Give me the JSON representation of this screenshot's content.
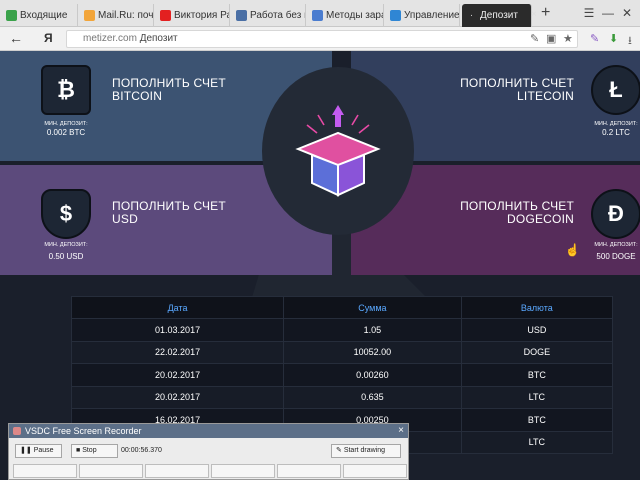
{
  "browser": {
    "tabs": [
      {
        "label": "Входящие",
        "color": "#3aa24a"
      },
      {
        "label": "Mail.Ru: почта",
        "color": "#f2a53a"
      },
      {
        "label": "Виктория Раб",
        "color": "#e32020"
      },
      {
        "label": "Работа без вл",
        "color": "#4a6fa5"
      },
      {
        "label": "Методы зараб",
        "color": "#4a7ccf"
      },
      {
        "label": "Управление н",
        "color": "#2f86d4"
      },
      {
        "label": "Депозит",
        "color": "#2b2b2b"
      }
    ],
    "active_tab": 6,
    "tab_close": "×",
    "new_tab": "+",
    "back": "←",
    "logo": "Я",
    "url_host": "metizer.com",
    "url_title": "Депозит"
  },
  "cards": [
    {
      "title_line1": "ПОПОЛНИТЬ СЧЕТ",
      "title_line2": "BITCOIN",
      "min_label": "МИН. ДЕПОЗИТ:",
      "min_value": "0.002 BTC",
      "icon": "bitcoin-icon",
      "glyph": "₿",
      "color": "#3c5372"
    },
    {
      "title_line1": "ПОПОЛНИТЬ СЧЕТ",
      "title_line2": "LITECOIN",
      "min_label": "МИН. ДЕПОЗИТ:",
      "min_value": "0.2 LTC",
      "icon": "litecoin-icon",
      "glyph": "Ł",
      "color": "#323f5d"
    },
    {
      "title_line1": "ПОПОЛНИТЬ СЧЕТ",
      "title_line2": "USD",
      "min_label": "МИН. ДЕПОЗИТ:",
      "min_value": "0.50 USD",
      "icon": "dollar-icon",
      "glyph": "$",
      "color": "#5c4a7c"
    },
    {
      "title_line1": "ПОПОЛНИТЬ СЧЕТ",
      "title_line2": "DOGECOIN",
      "min_label": "МИН. ДЕПОЗИТ:",
      "min_value": "500 DOGE",
      "icon": "dogecoin-icon",
      "glyph": "Ð",
      "color": "#562c5a"
    }
  ],
  "table": {
    "headers": [
      "Дата",
      "Сумма",
      "Валюта"
    ],
    "rows": [
      [
        "01.03.2017",
        "1.05",
        "USD"
      ],
      [
        "22.02.2017",
        "10052.00",
        "DOGE"
      ],
      [
        "20.02.2017",
        "0.00260",
        "BTC"
      ],
      [
        "20.02.2017",
        "0.635",
        "LTC"
      ],
      [
        "16.02.2017",
        "0.00250",
        "BTC"
      ],
      [
        "",
        "",
        "LTC"
      ]
    ]
  },
  "recorder": {
    "title": "VSDC Free Screen Recorder",
    "pause": "Pause",
    "stop": "Stop",
    "time": "00:00:56.370",
    "start_drawing": "Start drawing",
    "close": "×"
  }
}
